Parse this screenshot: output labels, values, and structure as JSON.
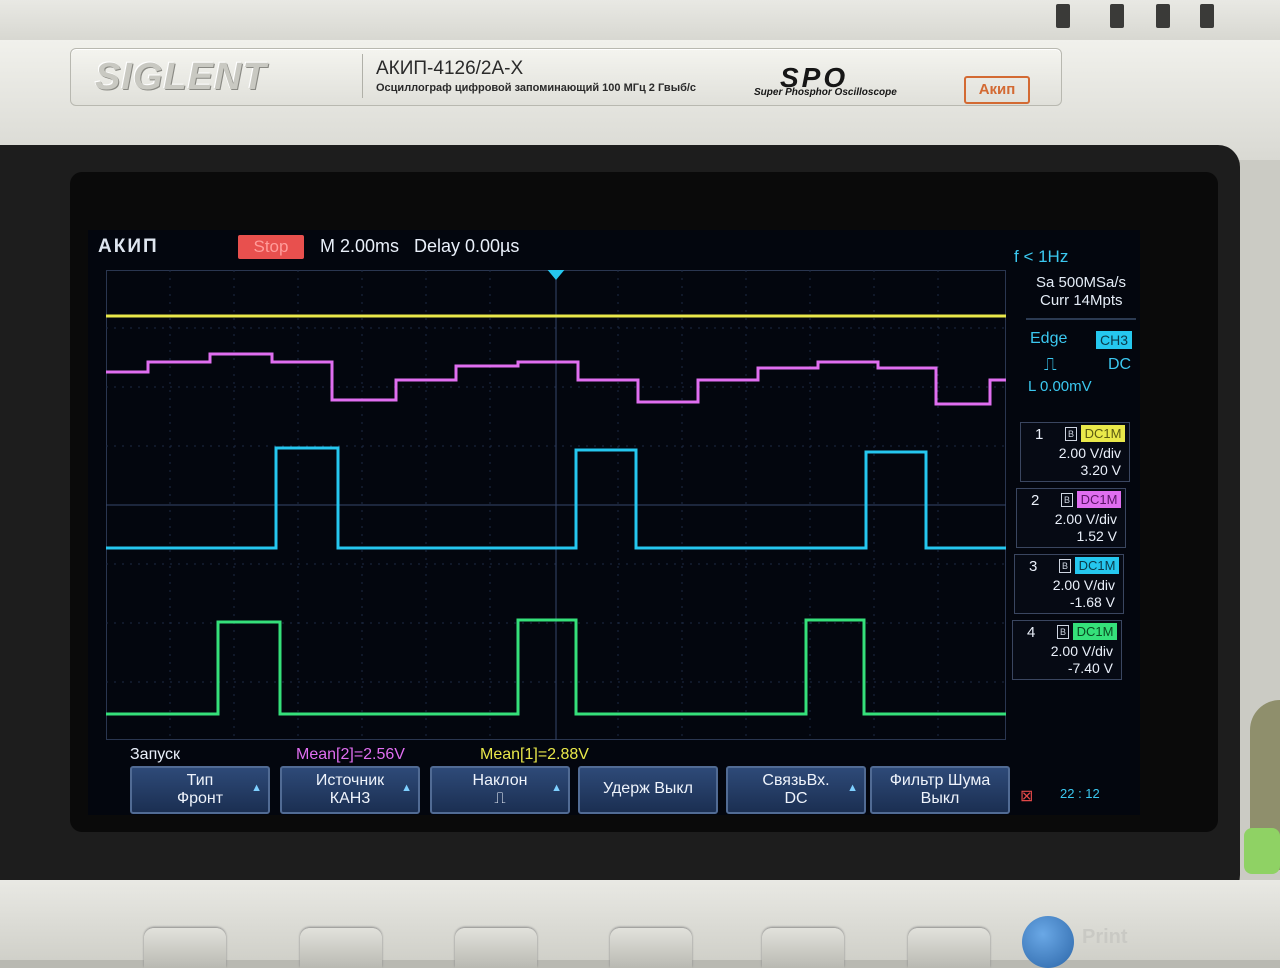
{
  "brand": {
    "name": "SIGLENT",
    "model": "АКИП-4126/2А-Х",
    "model_subtitle": "Осциллограф цифровой запоминающий  100 МГц  2 Гвыб/с",
    "spo": "SPO",
    "spo_subtitle": "Super Phosphor Oscilloscope",
    "dealer_logo": "Акип"
  },
  "status_bar": {
    "logo": "АКИП",
    "run_state": "Stop",
    "timebase": "M 2.00ms",
    "delay": "Delay 0.00µs",
    "freq": "f < 1Hz"
  },
  "acquisition": {
    "sample_rate": "Sa 500MSa/s",
    "memory": "Curr 14Mpts"
  },
  "trigger": {
    "type": "Edge",
    "source": "CH3",
    "slope_icon": "rising-edge-icon",
    "coupling": "DC",
    "level": "L  0.00mV"
  },
  "channels": [
    {
      "num": "1",
      "coupling": "DC1M",
      "vdiv": "2.00 V/div",
      "offset": "3.20 V",
      "color": "#e9e84a"
    },
    {
      "num": "2",
      "coupling": "DC1M",
      "vdiv": "2.00 V/div",
      "offset": "1.52 V",
      "color": "#e06ef0"
    },
    {
      "num": "3",
      "coupling": "DC1M",
      "vdiv": "2.00 V/div",
      "offset": "-1.68 V",
      "color": "#25c7ef"
    },
    {
      "num": "4",
      "coupling": "DC1M",
      "vdiv": "2.00 V/div",
      "offset": "-7.40 V",
      "color": "#35e07a"
    }
  ],
  "channel_markers": [
    "1",
    "2",
    "3",
    "4"
  ],
  "measurements": {
    "menu_title": "Запуск",
    "mean2": "Mean[2]=2.56V",
    "mean1": "Mean[1]=2.88V"
  },
  "softkeys": [
    {
      "l1": "Тип",
      "l2": "Фронт"
    },
    {
      "l1": "Источник",
      "l2": "КАН3"
    },
    {
      "l1": "Наклон",
      "l2": "⎍"
    },
    {
      "single": "Удерж Выкл"
    },
    {
      "l1": "СвязьВх.",
      "l2": "DC"
    },
    {
      "l1": "Фильтр Шума",
      "l2": "Выкл"
    }
  ],
  "clock": "22 : 12",
  "print_label": "Print"
}
